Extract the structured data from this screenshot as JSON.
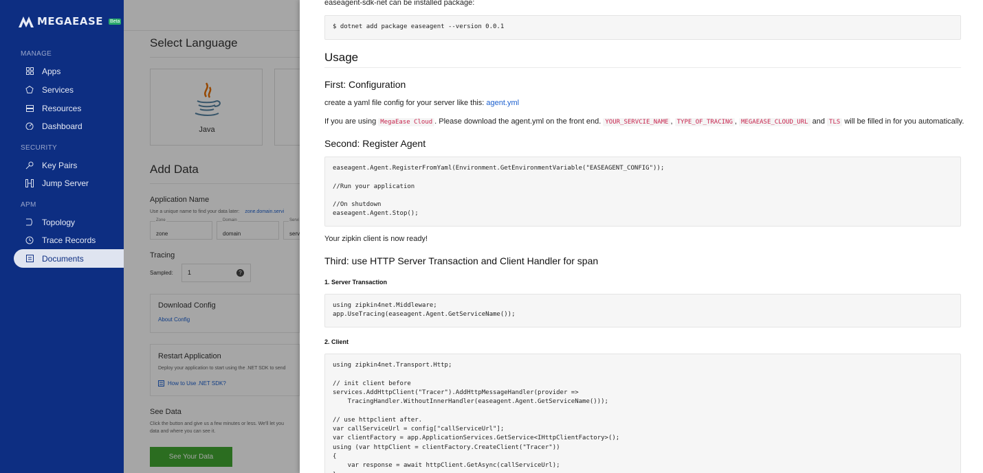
{
  "brand": {
    "name": "MEGAEASE",
    "badge": "Beta"
  },
  "sidebar": {
    "sections": [
      {
        "label": "MANAGE",
        "items": [
          {
            "label": "Apps",
            "icon": "grid-icon"
          },
          {
            "label": "Services",
            "icon": "services-icon"
          },
          {
            "label": "Resources",
            "icon": "server-icon"
          },
          {
            "label": "Dashboard",
            "icon": "gauge-icon"
          }
        ]
      },
      {
        "label": "SECURITY",
        "items": [
          {
            "label": "Key Pairs",
            "icon": "key-icon"
          },
          {
            "label": "Jump Server",
            "icon": "jump-icon"
          }
        ]
      },
      {
        "label": "APM",
        "items": [
          {
            "label": "Topology",
            "icon": "topology-icon"
          },
          {
            "label": "Trace Records",
            "icon": "clock-icon"
          },
          {
            "label": "Documents",
            "icon": "document-icon"
          }
        ]
      }
    ]
  },
  "background": {
    "select_language": "Select Language",
    "java_label": "Java",
    "add_data": "Add Data",
    "application_name": "Application Name",
    "app_hint": "Use a unique name to find your data later:",
    "app_hint_link": "zone.domain.servi",
    "fields": [
      {
        "label": "Zone",
        "value": "zone"
      },
      {
        "label": "Domain",
        "value": "domain"
      },
      {
        "label": "Servi",
        "value": "servi"
      }
    ],
    "tracing": "Tracing",
    "sampled_label": "Sampled:",
    "sampled_value": "1",
    "download_config": "Download Config",
    "about_config": "About Config",
    "restart_application": "Restart Application",
    "restart_desc": "Deploy your application to start using the .NET SDK to send",
    "how_to": "How to Use .NET SDK?",
    "see_data": "See Data",
    "see_data_desc1": "Click the button and give us a few minutes or less. We'll let you",
    "see_data_desc2": "data and where you can see it.",
    "see_your_data": "See Your Data"
  },
  "doc": {
    "intro": "easeagent-sdk-net can be installed package:",
    "install_code": "$ dotnet add package easeagent --version 0.0.1",
    "usage": "Usage",
    "first_heading": "First: Configuration",
    "config_text": "create a yaml file config for your server like this: ",
    "config_link": "agent.yml",
    "cloud_p1": "If you are using ",
    "cloud_code": "MegaEase Cloud",
    "cloud_p2": ". Please download the agent.yml on the front end. ",
    "var1": "YOUR_SERVCIE_NAME",
    "sep1": ", ",
    "var2": "TYPE_OF_TRACING",
    "sep2": ", ",
    "var3": "MEGAEASE_CLOUD_URL",
    "and": " and ",
    "var4": "TLS",
    "cloud_p3": " will be filled in for you automatically.",
    "second_heading": "Second: Register Agent",
    "register_code": "easeagent.Agent.RegisterFromYaml(Environment.GetEnvironmentVariable(\"EASEAGENT_CONFIG\"));\n\n//Run your application\n\n//On shutdown\neaseagent.Agent.Stop();",
    "ready_text": "Your zipkin client is now ready!",
    "third_heading": "Third: use HTTP Server Transaction and Client Handler for span",
    "server_tx": "1. Server Transaction",
    "server_code": "using zipkin4net.Middleware;\napp.UseTracing(easeagent.Agent.GetServiceName());",
    "client": "2. Client",
    "client_code": "using zipkin4net.Transport.Http;\n\n// init client before\nservices.AddHttpClient(\"Tracer\").AddHttpMessageHandler(provider =>\n    TracingHandler.WithoutInnerHandler(easeagent.Agent.GetServiceName()));\n\n// use httpclient after.\nvar callServiceUrl = config[\"callServiceUrl\"];\nvar clientFactory = app.ApplicationServices.GetService<IHttpClientFactory>();\nusing (var httpClient = clientFactory.CreateClient(\"Tracer\"))\n{\n    var response = await httpClient.GetAsync(callServiceUrl);\n}"
  },
  "colors": {
    "sidebar": "#0d2e82",
    "link": "#1b5fce",
    "button": "#42a832",
    "code_accent": "#c7254e"
  }
}
